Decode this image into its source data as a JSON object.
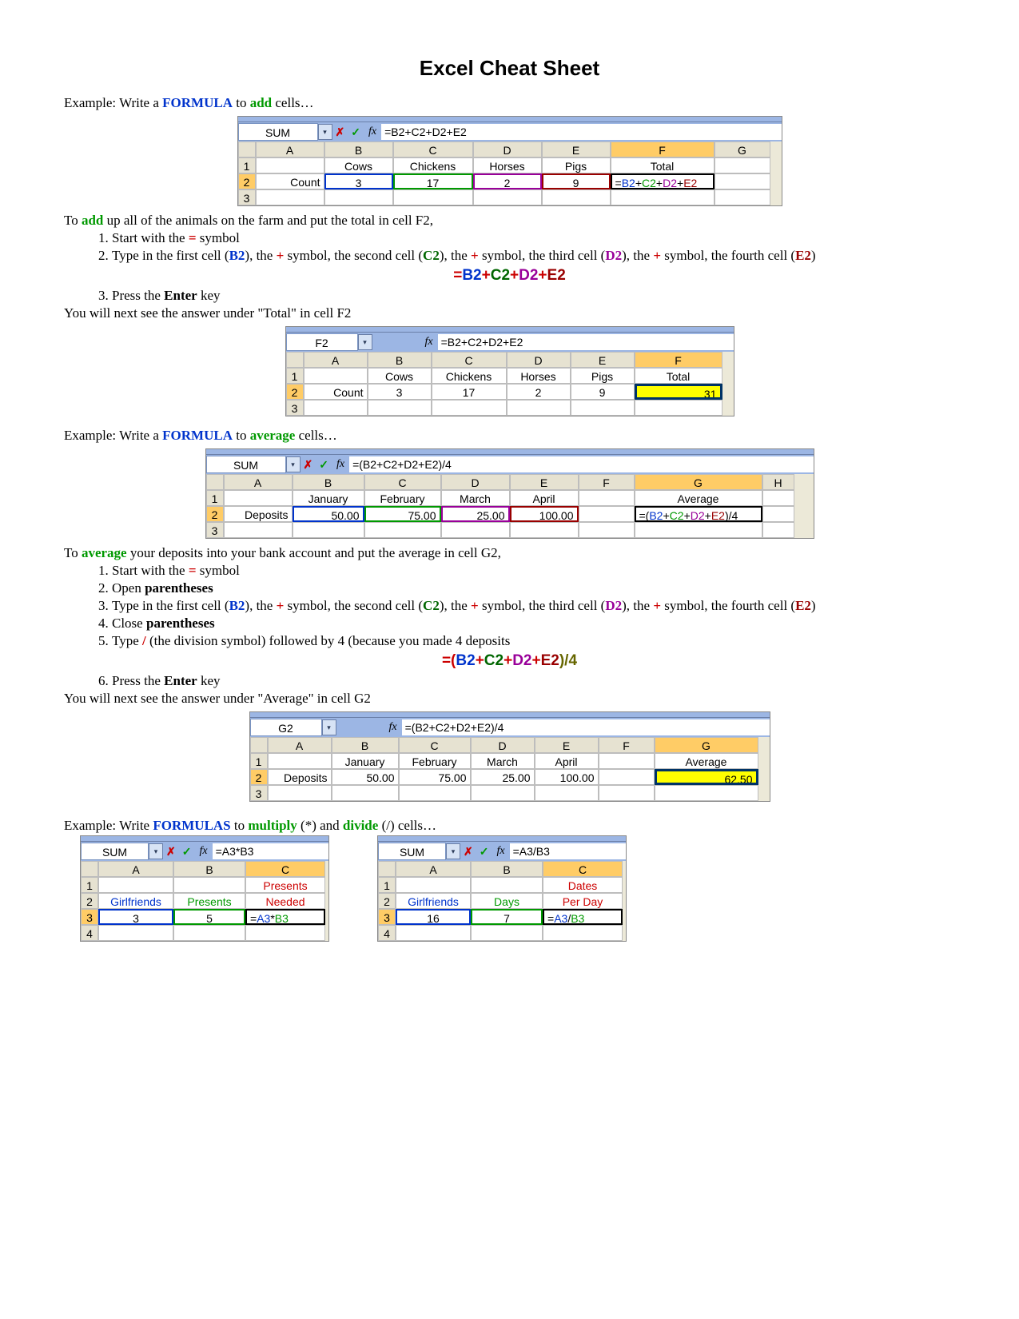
{
  "title": "Excel Cheat Sheet",
  "intro_add": {
    "prefix": "Example: Write a ",
    "formula_word": "FORMULA",
    "mid": " to ",
    "action_word": "add",
    "suffix": " cells…"
  },
  "add_ex": {
    "namebox": "SUM",
    "formula": "=B2+C2+D2+E2",
    "cols": [
      "A",
      "B",
      "C",
      "D",
      "E",
      "F",
      "G"
    ],
    "row1": [
      "",
      "Cows",
      "Chickens",
      "Horses",
      "Pigs",
      "Total",
      ""
    ],
    "row2_label": "Count",
    "row2_vals": [
      "3",
      "17",
      "2",
      "9"
    ],
    "row2_f": "=B2+C2+D2+E2",
    "row3_num": "3"
  },
  "add_explain": {
    "line1a": "To ",
    "line1_word": "add",
    "line1b": " up all of the animals on the farm and put the total in cell F2,",
    "step1a": "Start with the ",
    "step1_sym": "=",
    "step1b": " symbol",
    "step2a": "Type in the first cell (",
    "b2": "B2",
    "step2b": "), the ",
    "plus": "+",
    "step2c": " symbol, the second cell (",
    "c2": "C2",
    "step2d": "), the ",
    "step2e": " symbol, the third cell (",
    "d2": "D2",
    "step2f": "), the ",
    "step2g": " symbol, the fourth cell (",
    "e2": "E2",
    "step2h": ")",
    "step3a": "Press the ",
    "enter": "Enter",
    "step3b": " key",
    "result_line": "You will next see the answer under \"Total\" in cell F2"
  },
  "add_result": {
    "namebox": "F2",
    "formula": "=B2+C2+D2+E2",
    "cols": [
      "A",
      "B",
      "C",
      "D",
      "E",
      "F"
    ],
    "row1": [
      "",
      "Cows",
      "Chickens",
      "Horses",
      "Pigs",
      "Total"
    ],
    "row2_label": "Count",
    "row2_vals": [
      "3",
      "17",
      "2",
      "9"
    ],
    "row2_total": "31",
    "row3_num": "3"
  },
  "intro_avg": {
    "prefix": "Example: Write a ",
    "formula_word": "FORMULA",
    "mid": " to ",
    "action_word": "average",
    "suffix": " cells…"
  },
  "avg_ex": {
    "namebox": "SUM",
    "formula": "=(B2+C2+D2+E2)/4",
    "cols": [
      "A",
      "B",
      "C",
      "D",
      "E",
      "F",
      "G",
      "H"
    ],
    "row1": [
      "",
      "January",
      "February",
      "March",
      "April",
      "",
      "Average",
      ""
    ],
    "row2_label": "Deposits",
    "row2_vals": [
      "50.00",
      "75.00",
      "25.00",
      "100.00"
    ],
    "row2_g": "=(B2+C2+D2+E2)/4",
    "row3_num": "3"
  },
  "avg_explain": {
    "line1a": "To ",
    "line1_word": "average",
    "line1b": " your deposits into your bank account and put the average in cell G2,",
    "step1a": "Start with the ",
    "step1_sym": "=",
    "step1b": " symbol",
    "step2": "Open ",
    "paren": "parentheses",
    "step3a": "Type in the first cell (",
    "b2": "B2",
    "step3b": "), the ",
    "plus": "+",
    "step3c": " symbol, the second cell (",
    "c2": "C2",
    "step3d": "), the ",
    "step3e": " symbol, the third cell (",
    "d2": "D2",
    "step3f": "), the ",
    "step3g": " symbol, the fourth cell (",
    "e2": "E2",
    "step3h": ")",
    "step4": "Close ",
    "step5a": "Type ",
    "slash": "/",
    "step5b": " (the division symbol) followed by 4 (because you made 4 deposits",
    "step6a": "Press the ",
    "enter": "Enter",
    "step6b": " key",
    "result_line": "You will next see the answer under \"Average\" in cell G2"
  },
  "avg_result": {
    "namebox": "G2",
    "formula": "=(B2+C2+D2+E2)/4",
    "cols": [
      "A",
      "B",
      "C",
      "D",
      "E",
      "F",
      "G"
    ],
    "row1": [
      "",
      "January",
      "February",
      "March",
      "April",
      "",
      "Average"
    ],
    "row2_label": "Deposits",
    "row2_vals": [
      "50.00",
      "75.00",
      "25.00",
      "100.00"
    ],
    "row2_avg": "62.50",
    "row3_num": "3"
  },
  "intro_muldiv": {
    "prefix": "Example: Write ",
    "formulas_word": "FORMULAS",
    "mid1": " to ",
    "mult": "multiply",
    "mid2": " (*) and ",
    "div": "divide",
    "suffix": " (/) cells…"
  },
  "mult_ex": {
    "namebox": "SUM",
    "formula": "=A3*B3",
    "cols": [
      "A",
      "B",
      "C"
    ],
    "row1_c": "Presents",
    "row2": [
      "Girlfriends",
      "Presents",
      "Needed"
    ],
    "row3": [
      "3",
      "5",
      "=A3*B3"
    ],
    "row4_num": "4"
  },
  "div_ex": {
    "namebox": "SUM",
    "formula": "=A3/B3",
    "cols": [
      "A",
      "B",
      "C"
    ],
    "row1_c": "Dates",
    "row2": [
      "Girlfriends",
      "Days",
      "Per Day"
    ],
    "row3": [
      "16",
      "7",
      "=A3/B3"
    ],
    "row4_num": "4"
  },
  "formula_display_add": {
    "eq": "=",
    "b2": "B2",
    "p1": "+",
    "c2": "C2",
    "p2": "+",
    "d2": "D2",
    "p3": "+",
    "e2": "E2"
  },
  "formula_display_avg": {
    "eq_open": "=(",
    "b2": "B2",
    "p1": "+",
    "c2": "C2",
    "p2": "+",
    "d2": "D2",
    "p3": "+",
    "e2": "E2",
    "close_div": ")/4"
  },
  "fx_label": "fx",
  "x_icon": "✗",
  "check_icon": "✓",
  "tri": "▾"
}
